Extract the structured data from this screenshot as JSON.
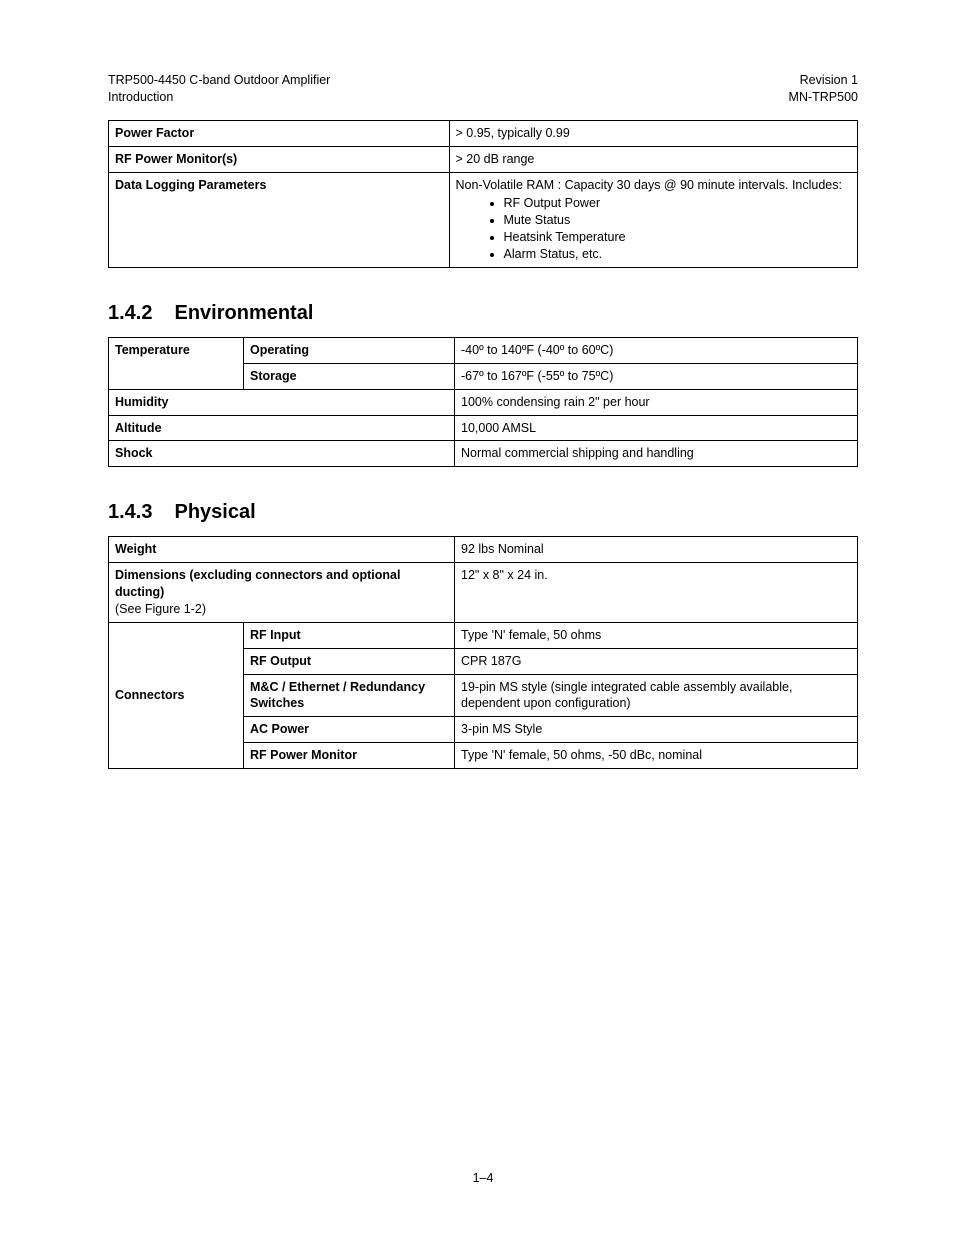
{
  "header": {
    "left_line1": "TRP500-4450 C-band Outdoor Amplifier",
    "left_line2": "Introduction",
    "right_line1": "Revision 1",
    "right_line2": "MN-TRP500"
  },
  "table_top": {
    "power_factor": {
      "label": "Power Factor",
      "value": "> 0.95, typically 0.99"
    },
    "rf_monitor": {
      "label": "RF Power Monitor(s)",
      "value": "> 20 dB range"
    },
    "data_logging": {
      "label": "Data Logging Parameters",
      "lead": "Non-Volatile RAM : Capacity 30 days @ 90 minute intervals. Includes:",
      "items": [
        "RF Output Power",
        "Mute Status",
        "Heatsink Temperature",
        "Alarm Status, etc."
      ]
    }
  },
  "sec_env": {
    "num": "1.4.2",
    "title": "Environmental"
  },
  "table_env": {
    "temperature": {
      "label": "Temperature",
      "operating": {
        "label": "Operating",
        "value": "-40º to 140ºF (-40º to 60ºC)"
      },
      "storage": {
        "label": "Storage",
        "value": "-67º to 167ºF (-55º to 75ºC)"
      }
    },
    "humidity": {
      "label": "Humidity",
      "value": "100% condensing rain 2\" per hour"
    },
    "altitude": {
      "label": "Altitude",
      "value": "10,000 AMSL"
    },
    "shock": {
      "label": "Shock",
      "value": "Normal commercial shipping and handling"
    }
  },
  "sec_phys": {
    "num": "1.4.3",
    "title": "Physical"
  },
  "table_phys": {
    "weight": {
      "label": "Weight",
      "value": "92 lbs Nominal"
    },
    "dimensions": {
      "label_line1": "Dimensions (excluding connectors and optional ducting)",
      "label_line2": "(See Figure 1-2)",
      "value": "12\" x 8\" x 24 in."
    },
    "connectors": {
      "label": "Connectors",
      "rf_input": {
        "label": "RF Input",
        "value": "Type 'N' female, 50 ohms"
      },
      "rf_output": {
        "label": "RF Output",
        "value": "CPR 187G"
      },
      "mc": {
        "label": "M&C / Ethernet / Redundancy Switches",
        "value": "19-pin MS style (single integrated cable assembly available, dependent upon configuration)"
      },
      "ac_power": {
        "label": "AC Power",
        "value": "3-pin MS Style"
      },
      "rf_mon": {
        "label": "RF Power Monitor",
        "value": "Type 'N' female, 50 ohms, -50 dBc, nominal"
      }
    }
  },
  "footer": {
    "page": "1–4"
  }
}
